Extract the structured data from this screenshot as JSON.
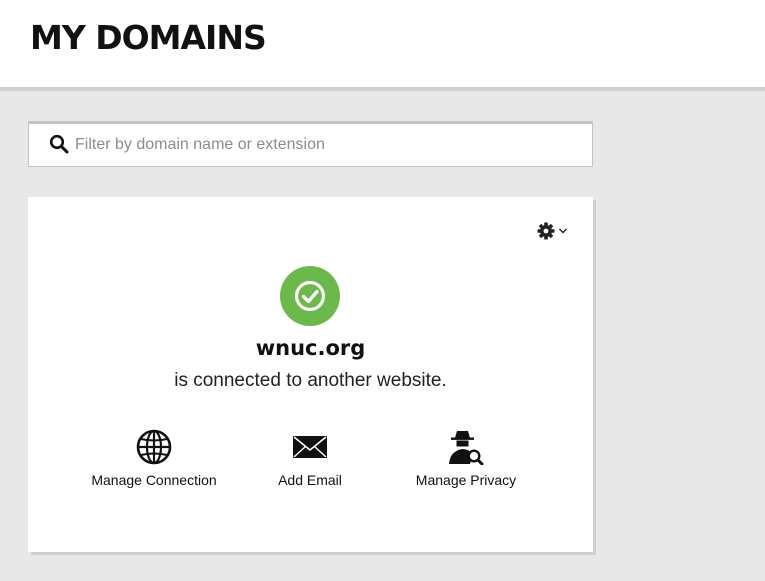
{
  "header": {
    "title": "MY DOMAINS"
  },
  "search": {
    "placeholder": "Filter by domain name or extension",
    "value": ""
  },
  "domain_card": {
    "domain": "wnuc.org",
    "status": "is connected to another website.",
    "status_color": "#6ab94a",
    "actions": [
      {
        "label": "Manage Connection",
        "icon": "globe-icon"
      },
      {
        "label": "Add Email",
        "icon": "envelope-icon"
      },
      {
        "label": "Manage Privacy",
        "icon": "privacy-agent-icon"
      }
    ],
    "settings_icon": "gear-icon"
  }
}
